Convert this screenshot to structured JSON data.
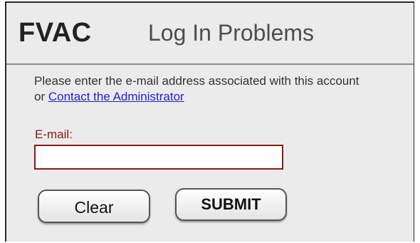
{
  "header": {
    "brand": "FVAC",
    "title": "Log In Problems"
  },
  "form": {
    "instruction_text": "Please enter the e-mail address associated with this account or ",
    "contact_link": "Contact the Administrator",
    "email_label": "E-mail:",
    "email_value": "",
    "clear_label": "Clear",
    "submit_label": "SUBMIT"
  },
  "colors": {
    "panel_background": "#ebebeb",
    "label_color": "#8b1a10",
    "link_color": "#2121d4"
  }
}
